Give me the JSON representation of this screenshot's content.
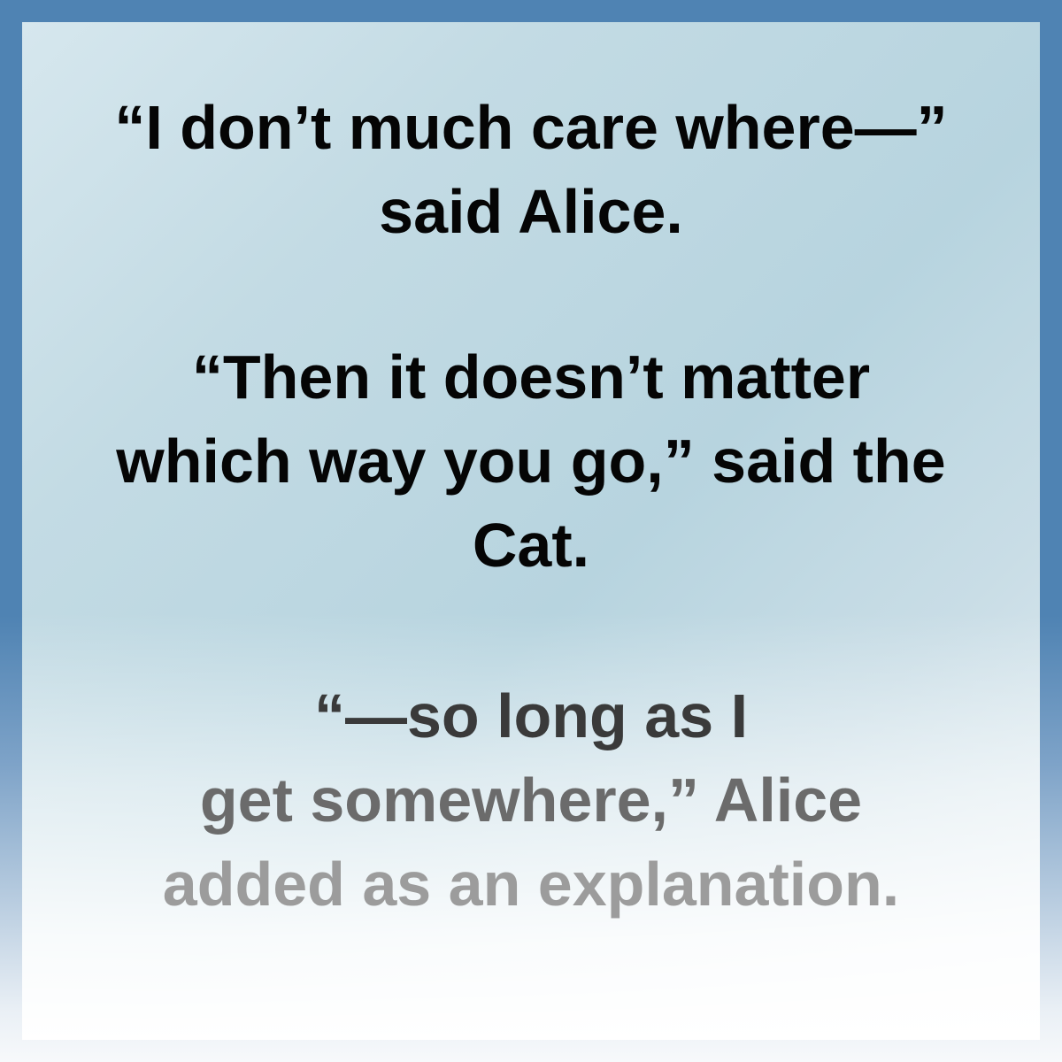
{
  "quotes": [
    {
      "lines": [
        "“I don’t much care where—”",
        "said Alice."
      ]
    },
    {
      "lines": [
        "“Then it doesn’t matter",
        "which way you go,” said the",
        "Cat."
      ]
    },
    {
      "lines": [
        "“—so long as I",
        "get somewhere,” Alice",
        "added as an explanation."
      ]
    }
  ],
  "colors": {
    "frame_top": "#4f83b3",
    "text_primary": "#050505",
    "fade_1": "#3a3a3a",
    "fade_2": "#6b6b6b",
    "fade_3": "#9c9c9c"
  }
}
